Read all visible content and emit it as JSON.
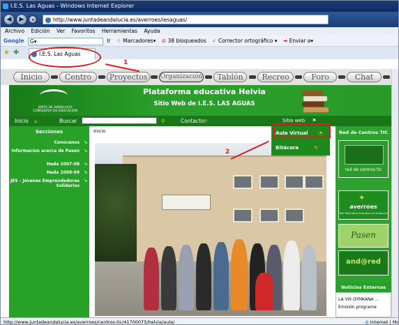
{
  "window": {
    "title": "I.E.S. Las Aguas - Windows Internet Explorer"
  },
  "address": {
    "url": "http://www.juntadeandalucia.es/averroes/iesaguas/"
  },
  "menubar": {
    "items": [
      "Archivo",
      "Edición",
      "Ver",
      "Favoritos",
      "Herramientas",
      "Ayuda"
    ]
  },
  "google_toolbar": {
    "brand": "Google",
    "placeholder": "G▾",
    "ir_label": "Ir",
    "marcadores": "Marcadores▾",
    "bloqueados": "38 bloqueados",
    "corrector": "Corrector ortográfico ▾",
    "enviar": "Enviar a▾"
  },
  "tab": {
    "label": "I.E.S. Las Aguas"
  },
  "annotations": {
    "one": "1",
    "two": "2"
  },
  "site_nav": {
    "items": [
      "Inicio",
      "Centro",
      "Proyectos",
      "Organización",
      "Tablón",
      "Recreo",
      "Foro",
      "Chat"
    ]
  },
  "header": {
    "title": "Plataforma educativa Helvia",
    "subtitle": "Sitio Web de I.E.S. LAS AGUAS",
    "logo_text": "JUNTA DE ANDALUCIA",
    "logo_sub": "CONSEJERIA DE EDUCACION"
  },
  "toolbar": {
    "inicio": "Inicio",
    "buscar": "Buscar",
    "contacto": "Contacto",
    "sitio_web": "Sitio web"
  },
  "sidebar": {
    "heading": "Secciones",
    "items": [
      "Conocenos",
      "Informacion acerca de Pasen",
      "Heda 2007-08",
      "Heda 2008-09",
      "JES - Jóvenes Emprendedores Solidarios"
    ]
  },
  "breadcrumb": "Inicio",
  "dropdown": {
    "items": [
      "Aula Virtual",
      "Bitácora"
    ]
  },
  "right_panel": {
    "heading": "Red de Centros TIC",
    "box1_label": "red de centros tic",
    "box2_label": "averroes",
    "box2_sub": "Red Telemática Educativa de Andalucía",
    "box3_label": "Pasen",
    "box4_label": "and@red",
    "news_heading": "Noticias Externas",
    "news": [
      "LA VIII GYMKANA ...",
      "Emisión programa"
    ]
  },
  "status": {
    "url": "http://www.juntadeandalucia.es/averroes/centros-tic/41700075/helvia/aula/",
    "zone": "Internet | Mo"
  },
  "colors": {
    "green": "#28a128",
    "dark_green": "#187818",
    "annotation_red": "#e21b1b",
    "ie_blue": "#1e3c74"
  }
}
